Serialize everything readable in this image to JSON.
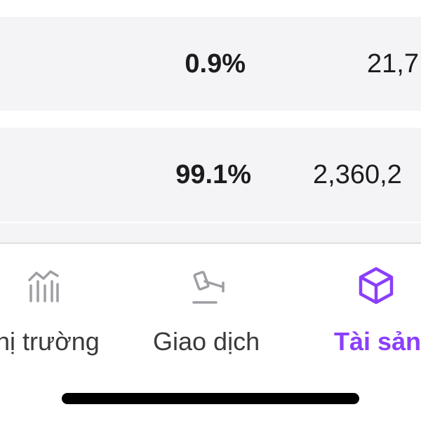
{
  "assets": {
    "rows": [
      {
        "percent": "0.9%",
        "amount": "21,7"
      },
      {
        "percent": "99.1%",
        "amount": "2,360,2"
      }
    ]
  },
  "tab_bar": {
    "tabs": [
      {
        "label": "hị trường",
        "icon": "chart-bars-icon",
        "active": false
      },
      {
        "label": "Giao dịch",
        "icon": "gavel-icon",
        "active": false
      },
      {
        "label": "Tài sản",
        "icon": "cube-icon",
        "active": true
      }
    ],
    "colors": {
      "active": "#8a3ffc",
      "inactive_icon": "#9e9ea3",
      "inactive_text": "#3a3a3c"
    }
  }
}
